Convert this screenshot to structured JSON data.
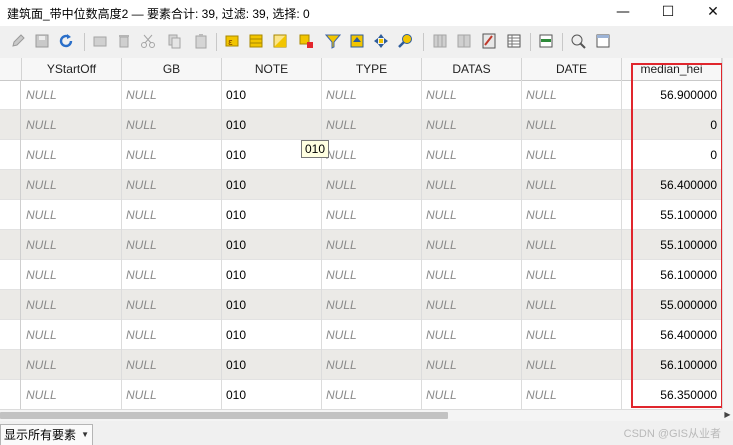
{
  "window": {
    "title": "建筑面_带中位数高度2 — 要素合计: 39, 过滤: 39, 选择: 0",
    "minimize_glyph": "—",
    "maximize_glyph": "☐",
    "close_glyph": "✕"
  },
  "toolbar": {
    "icons": [
      "toggle-editing-icon",
      "save-edits-icon",
      "reload-icon",
      "add-feature-icon",
      "delete-feature-icon",
      "cut-icon",
      "copy-icon",
      "paste-icon",
      "expression-select-icon",
      "select-all-icon",
      "invert-selection-icon",
      "deselect-icon",
      "filter-select-icon",
      "move-selection-top-icon",
      "pan-to-selected-icon",
      "zoom-to-selected-icon",
      "new-field-icon",
      "delete-field-icon",
      "field-calculator-icon",
      "conditional-format-icon",
      "dock-icon",
      "actions-icon",
      "table-view-icon"
    ]
  },
  "table": {
    "columns": [
      "YStartOff",
      "GB",
      "NOTE",
      "TYPE",
      "DATAS",
      "DATE",
      "median_hei"
    ],
    "rows": [
      [
        "NULL",
        "NULL",
        "010",
        "NULL",
        "NULL",
        "NULL",
        "56.900000"
      ],
      [
        "NULL",
        "NULL",
        "010",
        "NULL",
        "NULL",
        "NULL",
        "0"
      ],
      [
        "NULL",
        "NULL",
        "010",
        "NULL",
        "NULL",
        "NULL",
        "0"
      ],
      [
        "NULL",
        "NULL",
        "010",
        "NULL",
        "NULL",
        "NULL",
        "56.400000"
      ],
      [
        "NULL",
        "NULL",
        "010",
        "NULL",
        "NULL",
        "NULL",
        "55.100000"
      ],
      [
        "NULL",
        "NULL",
        "010",
        "NULL",
        "NULL",
        "NULL",
        "55.100000"
      ],
      [
        "NULL",
        "NULL",
        "010",
        "NULL",
        "NULL",
        "NULL",
        "56.100000"
      ],
      [
        "NULL",
        "NULL",
        "010",
        "NULL",
        "NULL",
        "NULL",
        "55.000000"
      ],
      [
        "NULL",
        "NULL",
        "010",
        "NULL",
        "NULL",
        "NULL",
        "56.400000"
      ],
      [
        "NULL",
        "NULL",
        "010",
        "NULL",
        "NULL",
        "NULL",
        "56.100000"
      ],
      [
        "NULL",
        "NULL",
        "010",
        "NULL",
        "NULL",
        "NULL",
        "56.350000"
      ]
    ]
  },
  "tooltip": {
    "text": "010"
  },
  "highlight": {
    "color": "#e0262d"
  },
  "colors": {
    "alt_row": "#ebeae7",
    "null_text": "#8a8a8a"
  },
  "statusbar": {
    "filter_label": "显示所有要素",
    "watermark": "CSDN @GIS从业者"
  }
}
